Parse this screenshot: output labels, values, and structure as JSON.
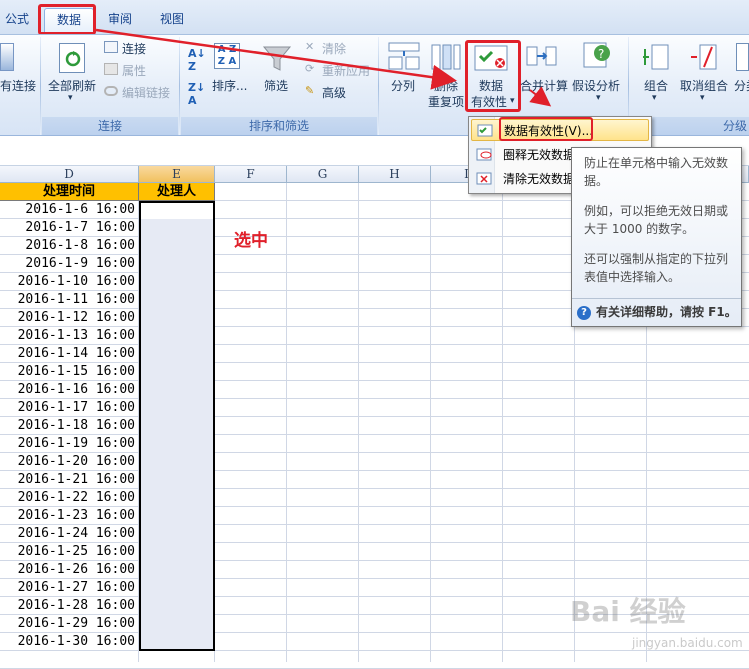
{
  "tabs": [
    {
      "label": "公式"
    },
    {
      "label": "数据"
    },
    {
      "label": "审阅"
    },
    {
      "label": "视图"
    }
  ],
  "ribbon": {
    "connections": {
      "existing": "有连接",
      "refresh_all": "全部刷新",
      "connect": "连接",
      "properties": "属性",
      "edit_links": "编辑链接",
      "group": "连接"
    },
    "sort_filter": {
      "sort": "排序...",
      "filter": "筛选",
      "clear": "清除",
      "reapply": "重新应用",
      "advanced": "高级",
      "group": "排序和筛选"
    },
    "data_tools": {
      "split": "分列",
      "remove_dup_1": "删除",
      "remove_dup_2": "重复项",
      "validation_1": "数据",
      "validation_2": "有效性",
      "consolidate": "合并计算",
      "whatif": "假设分析"
    },
    "outline": {
      "group_btn": "组合",
      "ungroup": "取消组合",
      "subtotal": "分类",
      "group": "分级"
    }
  },
  "menu": {
    "items": [
      {
        "label": "数据有效性(V)..."
      },
      {
        "label": "圈释无效数据"
      },
      {
        "label": "清除无效数据"
      }
    ]
  },
  "tooltip": {
    "p1": "防止在单元格中输入无效数据。",
    "p2": "例如，可以拒绝无效日期或大于 1000 的数字。",
    "p3": "还可以强制从指定的下拉列表值中选择输入。",
    "help": "有关详细帮助，请按 F1。"
  },
  "sheet": {
    "columns": [
      "D",
      "E",
      "F",
      "G",
      "H",
      "I"
    ],
    "header_d": "处理时间",
    "header_e": "处理人",
    "annotation": "选中",
    "dates": [
      "2016-1-6 16:00",
      "2016-1-7 16:00",
      "2016-1-8 16:00",
      "2016-1-9 16:00",
      "2016-1-10 16:00",
      "2016-1-11 16:00",
      "2016-1-12 16:00",
      "2016-1-13 16:00",
      "2016-1-14 16:00",
      "2016-1-15 16:00",
      "2016-1-16 16:00",
      "2016-1-17 16:00",
      "2016-1-18 16:00",
      "2016-1-19 16:00",
      "2016-1-20 16:00",
      "2016-1-21 16:00",
      "2016-1-22 16:00",
      "2016-1-23 16:00",
      "2016-1-24 16:00",
      "2016-1-25 16:00",
      "2016-1-26 16:00",
      "2016-1-27 16:00",
      "2016-1-28 16:00",
      "2016-1-29 16:00",
      "2016-1-30 16:00"
    ]
  },
  "watermark": {
    "brand": "Bai 经验",
    "url": "jingyan.baidu.com"
  },
  "colors": {
    "accent_red": "#e0202a",
    "header_yellow": "#ffc000",
    "selection_orange": "#f1c15f"
  }
}
